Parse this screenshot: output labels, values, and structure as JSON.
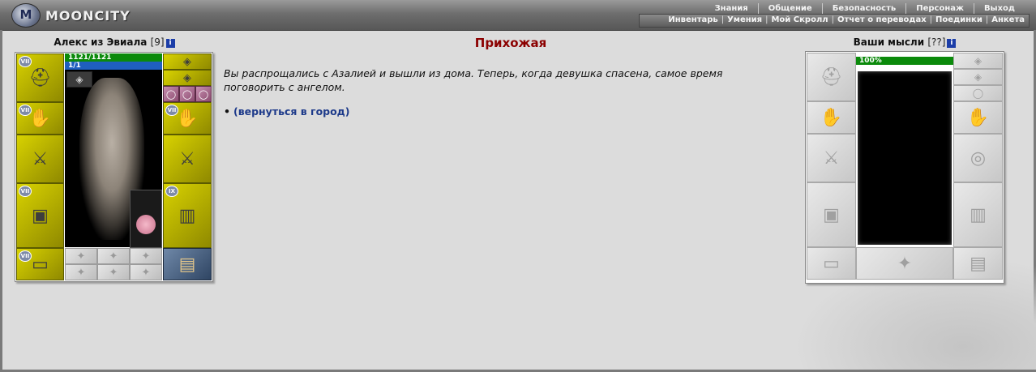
{
  "header": {
    "logo_text": "MOONCITY",
    "logo_emblem": "M",
    "top_menu": [
      "Знания",
      "Общение",
      "Безопасность",
      "Персонаж",
      "Выход"
    ],
    "sub_menu": [
      "Инвентарь",
      "Умения",
      "Мой Скролл",
      "Отчет о переводах",
      "Поединки",
      "Анкета"
    ]
  },
  "player": {
    "name": "Алекс из Эвиала",
    "level": "[9]",
    "info_icon": "i",
    "hp": "1121/1121",
    "mp": "1/1",
    "slot_badges": [
      "VII",
      "VII",
      "VII",
      "IX",
      "VII",
      "VII"
    ]
  },
  "location": {
    "title": "Прихожая",
    "story": "Вы распрощались с Азалией и вышли из дома. Теперь, когда девушка спасена, самое время поговорить с ангелом.",
    "bullet": "•",
    "action_label": "(вернуться в город)"
  },
  "opponent": {
    "name": "Ваши мысли",
    "level": "[??]",
    "info_icon": "i",
    "thought_level": "100%"
  },
  "icons": {
    "helmet": "⛑",
    "weapon": "⚔",
    "armor": "▣",
    "boots": "▤",
    "ring": "◯",
    "amulet": "◈",
    "shield": "◎",
    "gloves": "✋",
    "pants": "▥",
    "belt": "▭",
    "rune": "✦"
  }
}
